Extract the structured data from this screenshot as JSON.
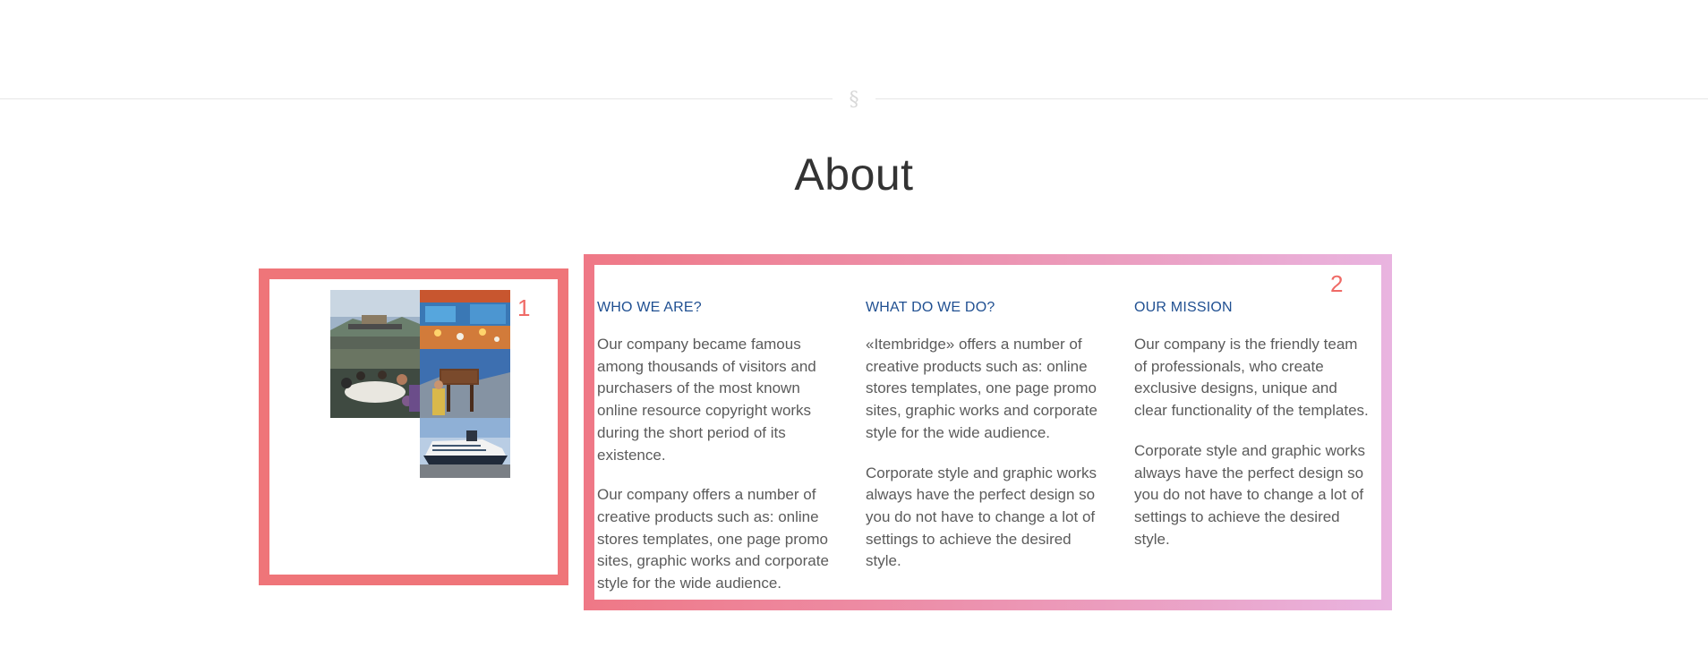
{
  "section": {
    "divider_symbol": "§",
    "title": "About"
  },
  "box1": {
    "number": "1",
    "images": [
      {
        "icon": "mountain-summit-photo-icon"
      },
      {
        "icon": "cruise-deck-photo-icon"
      },
      {
        "icon": "meeting-table-photo-icon"
      },
      {
        "icon": "mountain-sign-photo-icon"
      },
      {
        "icon": "cruise-ship-photo-icon"
      }
    ]
  },
  "box2": {
    "number": "2",
    "columns": [
      {
        "heading": "WHO WE ARE?",
        "paragraphs": [
          "Our company became famous among thousands of visitors and purchasers of the most known online resource copyright works during the short period of its existence.",
          "Our company offers a number of creative products such as: online stores templates, one page promo sites, graphic works and corporate style for the wide audience."
        ]
      },
      {
        "heading": "WHAT DO WE DO?",
        "paragraphs": [
          "«Itembridge» offers a number of creative products such as: online stores templates, one page promo sites, graphic works and corporate style for the wide audience.",
          "Corporate style and graphic works always have the perfect design so you do not have to change a lot of settings to achieve the desired style."
        ]
      },
      {
        "heading": "OUR MISSION",
        "paragraphs": [
          "Our company is the friendly team of professionals, who create exclusive designs, unique and clear functionality of the templates.",
          "Corporate style and graphic works always have the perfect design so you do not have to change a lot of settings to achieve the desired style."
        ]
      }
    ]
  },
  "colors": {
    "box1_border": "#ef7579",
    "box2_gradient_start": "#ef7886",
    "box2_gradient_end": "#e9b4e0",
    "heading": "#1f4f91",
    "number": "#ef6a66"
  }
}
